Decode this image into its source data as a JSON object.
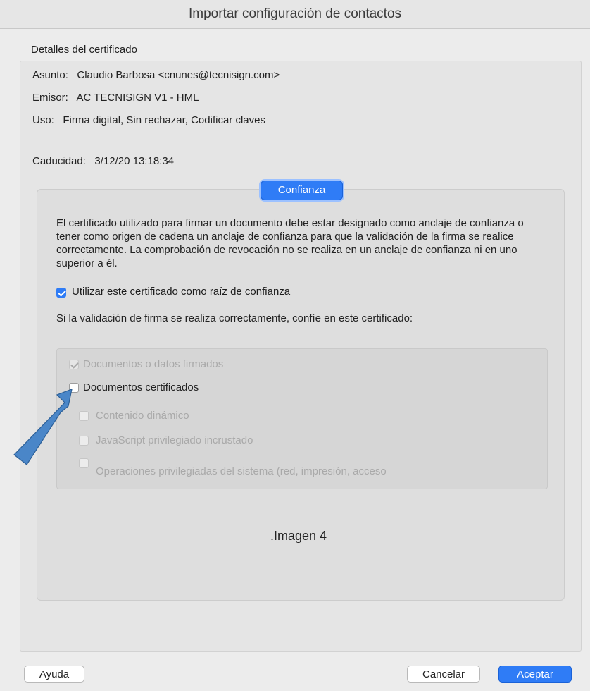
{
  "window": {
    "title": "Importar configuración de contactos"
  },
  "details": {
    "section_label": "Detalles del certificado",
    "subject_label": "Asunto:",
    "subject_value": "Claudio Barbosa <cnunes@tecnisign.com>",
    "issuer_label": "Emisor:",
    "issuer_value": "AC TECNISIGN V1 - HML",
    "usage_label": "Uso:",
    "usage_value": "Firma digital, Sin rechazar, Codificar claves",
    "expiry_label": "Caducidad:",
    "expiry_value": "3/12/20 13:18:34"
  },
  "trust": {
    "tab_label": "Confianza",
    "paragraph": "El certificado utilizado para firmar un documento debe estar designado como anclaje de confianza o tener como origen de cadena un anclaje de confianza para que la validación de la firma se realice correctamente. La comprobación de revocación no se realiza en un anclaje de confianza ni en uno superior a él.",
    "root_checkbox_label": "Utilizar este certificado como raíz de confianza",
    "root_checked": true,
    "trust_prompt": "Si la validación de firma se realiza correctamente, confíe en este certificado:",
    "options": [
      {
        "label": "Documentos o datos firmados",
        "checked": true,
        "enabled": false
      },
      {
        "label": "Documentos certificados",
        "checked": false,
        "enabled": true
      },
      {
        "label": "Contenido dinámico",
        "checked": false,
        "enabled": false
      },
      {
        "label": "JavaScript privilegiado incrustado",
        "checked": false,
        "enabled": false
      },
      {
        "label": "Operaciones privilegiadas del sistema (red, impresión, acceso",
        "checked": false,
        "enabled": false
      }
    ],
    "caption": ".Imagen 4"
  },
  "buttons": {
    "help": "Ayuda",
    "cancel": "Cancelar",
    "accept": "Aceptar"
  },
  "colors": {
    "accent": "#2f7cf6",
    "annotation_arrow": "#4a86c8"
  }
}
